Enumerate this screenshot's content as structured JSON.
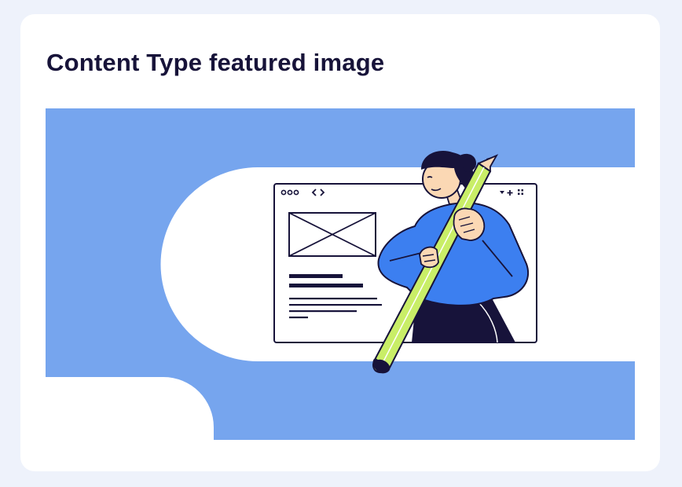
{
  "card": {
    "title": "Content Type featured image"
  },
  "illustration": {
    "description_icon": "person-holding-pencil-illustration",
    "colors": {
      "background_blue": "#76a5ee",
      "shape_white": "#ffffff",
      "outline": "#17133a",
      "shirt_blue": "#3c7ff0",
      "pencil_green": "#c9ee67",
      "skin": "#fbd8b4"
    }
  }
}
